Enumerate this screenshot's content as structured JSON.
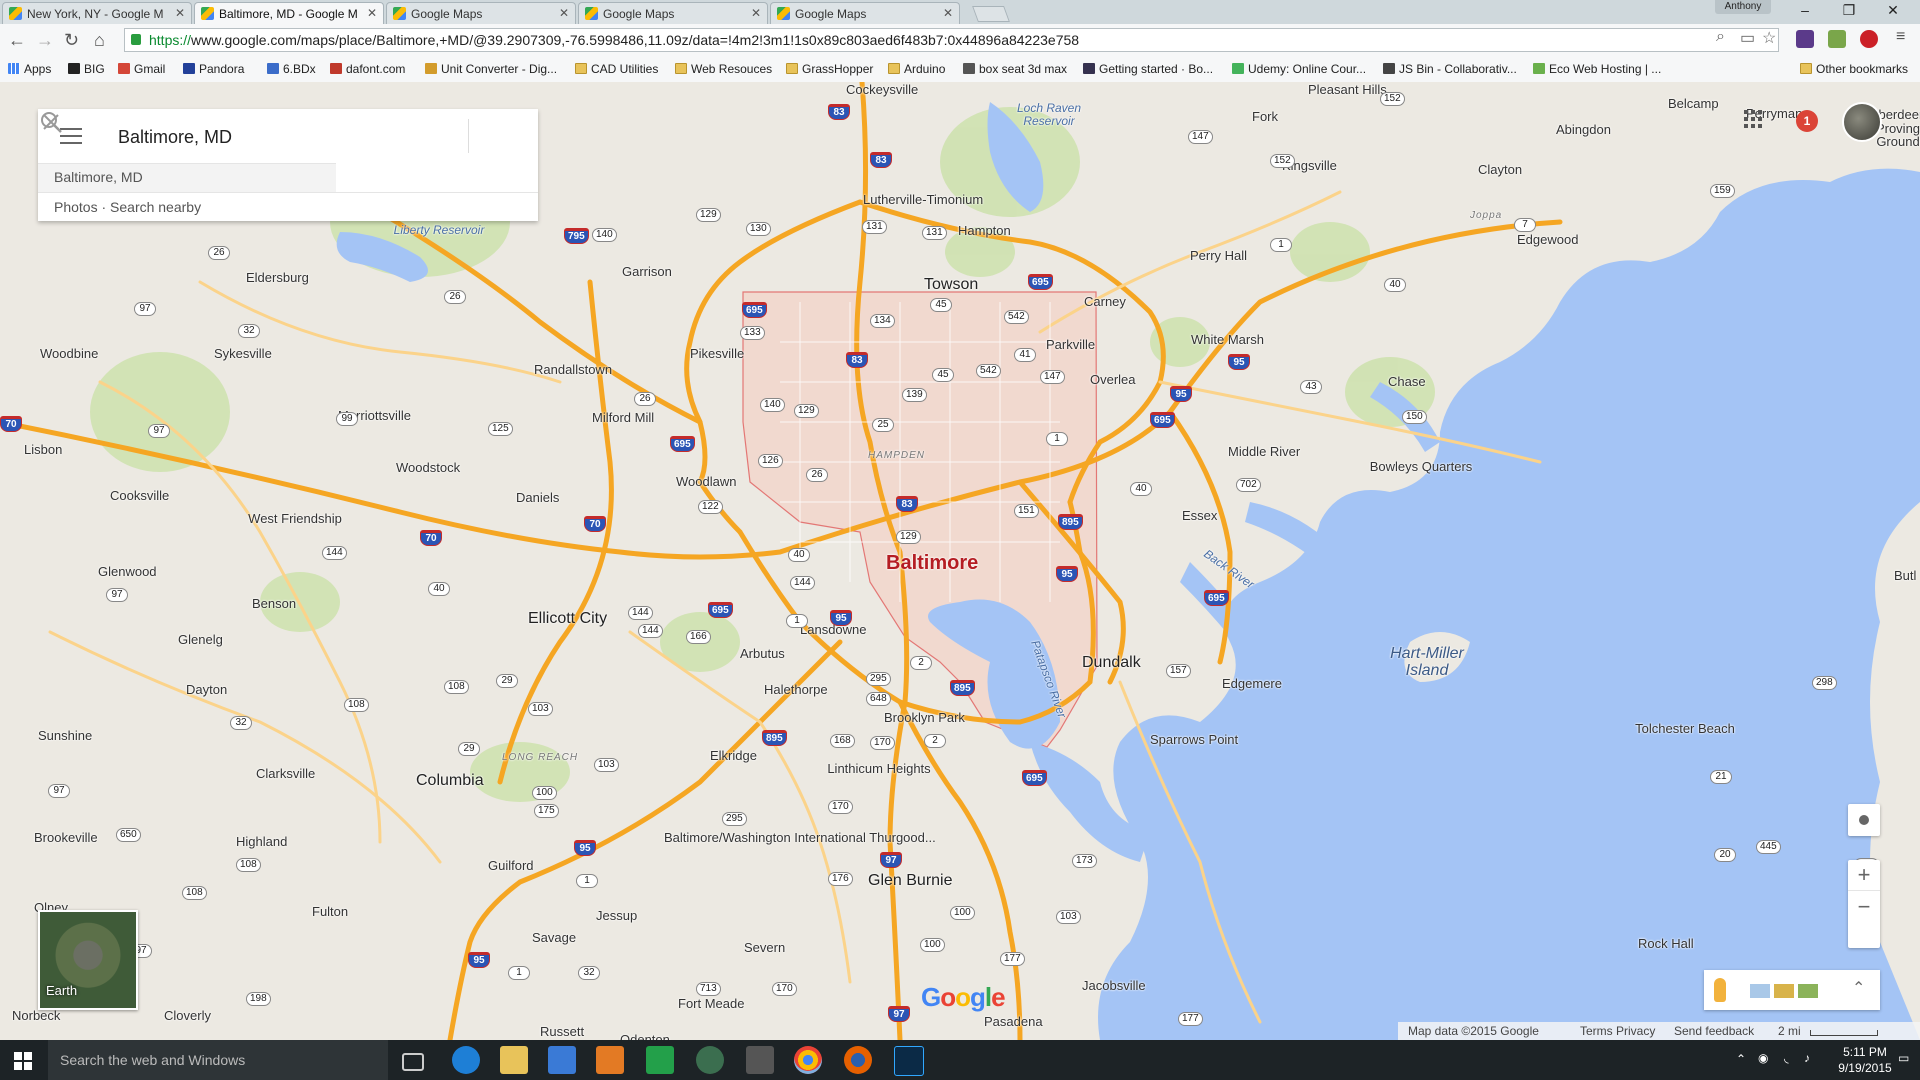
{
  "browser": {
    "tabs": [
      {
        "title": "New York, NY - Google M"
      },
      {
        "title": "Baltimore, MD - Google M"
      },
      {
        "title": "Google Maps"
      },
      {
        "title": "Google Maps"
      },
      {
        "title": "Google Maps"
      }
    ],
    "profile_name": "Anthony",
    "url_scheme": "https://",
    "url_rest": "www.google.com/maps/place/Baltimore,+MD/@39.2907309,-76.5998486,11.09z/data=!4m2!3m1!1s0x89c803aed6f483b7:0x44896a84223e758",
    "bookmarks": [
      "Apps",
      "BIG",
      "Gmail",
      "Pandora",
      "6.BDx",
      "dafont.com",
      "Unit Converter - Dig...",
      "CAD Utilities",
      "Web Resouces",
      "GrassHopper",
      "Arduino",
      "box seat 3d max",
      "Getting started · Bo...",
      "Udemy: Online Cour...",
      "JS Bin - Collaborativ...",
      "Eco Web Hosting | ..."
    ],
    "other_bookmarks": "Other bookmarks"
  },
  "search": {
    "value": "Baltimore, MD",
    "suggestion": "Baltimore, MD",
    "actions": "Photos · Search nearby"
  },
  "map": {
    "places": [
      "Cockeysville",
      "Loch Raven Reservoir",
      "Lutherville-Timonium",
      "Hampton",
      "Towson",
      "Carney",
      "Parkville",
      "Perry Hall",
      "White Marsh",
      "Kingsville",
      "Fork",
      "Clayton",
      "Joppa",
      "Edgewood",
      "Abingdon",
      "Belcamp",
      "Perryman",
      "Aberdeen Proving Ground",
      "Pleasant Hills",
      "Liberty Reservoir",
      "Garrison",
      "Eldersburg",
      "Sykesville",
      "Woodbine",
      "Randallstown",
      "Pikesville",
      "Marriottsville",
      "Milford Mill",
      "Lisbon",
      "Woodstock",
      "Woodlawn",
      "Cooksville",
      "Daniels",
      "West Friendship",
      "Glenwood",
      "Benson",
      "Ellicott City",
      "Glenelg",
      "Dayton",
      "Sunshine",
      "Clarksville",
      "Columbia",
      "Brookeville",
      "Highland",
      "Guilford",
      "Fulton",
      "Olney",
      "Jessup",
      "Savage",
      "Arbutus",
      "Halethorpe",
      "Elkridge",
      "Lansdowne",
      "Baltimore",
      "HAMPDEN",
      "Overlea",
      "Chase",
      "Middle River",
      "Bowleys Quarters",
      "Essex",
      "Back River",
      "Dundalk",
      "Edgemere",
      "Sparrows Point",
      "Hart-Miller Island",
      "Patapsco River",
      "Brooklyn Park",
      "Linthicum Heights",
      "Baltimore/Washington International Thurgood...",
      "Glen Burnie",
      "Severn",
      "Fort Meade",
      "Odenton",
      "Pasadena",
      "Jacobsville",
      "Tolchester Beach",
      "Rock Hall",
      "Norbeck",
      "Cloverly",
      "Russett",
      "LONG REACH",
      "Butl"
    ],
    "google_logo": "Google",
    "earth_label": "Earth",
    "notification_count": "1",
    "attribution": {
      "data": "Map data ©2015 Google",
      "terms": "Terms",
      "privacy": "Privacy",
      "feedback": "Send feedback",
      "scale": "2 mi"
    }
  },
  "taskbar": {
    "search_placeholder": "Search the web and Windows",
    "time": "5:11 PM",
    "date": "9/19/2015"
  },
  "colors": {
    "water": "#a4c4f5",
    "highway": "#f5a623",
    "boundary": "#e04848",
    "land": "#ece9e2",
    "park": "#c9dfa8"
  }
}
